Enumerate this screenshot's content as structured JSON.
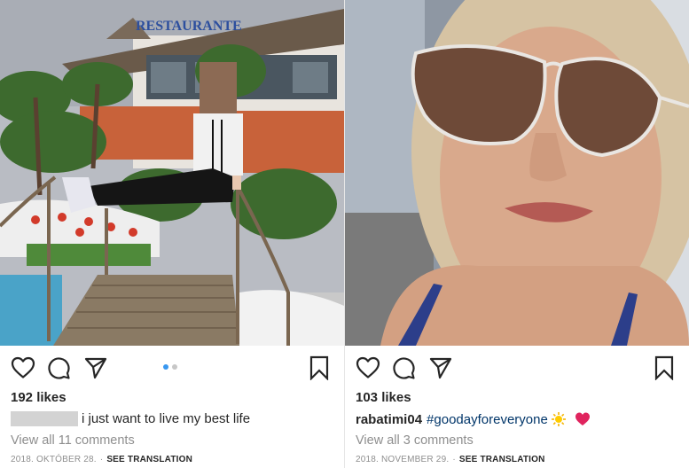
{
  "post_left": {
    "photo_description": "",
    "likes": "192 likes",
    "caption_text": "i just want to live my best life",
    "comments_link": "View all 11 comments",
    "date": "2018. OKTÓBER 28.",
    "separator": "·",
    "translation_link": "SEE TRANSLATION",
    "sign_text": "RESTAURANTE",
    "carousel": {
      "count": 2,
      "active_index": 0,
      "active_color": "#3897f0",
      "inactive_color": "#c7c7c7"
    },
    "icons": [
      "heart-icon",
      "comment-icon",
      "share-icon",
      "bookmark-icon"
    ]
  },
  "post_right": {
    "likes": "103 likes",
    "username": "rabatimi04",
    "hashtag": "#goodayforeveryone",
    "comments_link": "View all 3 comments",
    "date": "2018. NOVEMBER 29.",
    "separator": "·",
    "translation_link": "SEE TRANSLATION",
    "icons": [
      "heart-icon",
      "comment-icon",
      "share-icon",
      "bookmark-icon"
    ]
  },
  "colors": {
    "text": "#262626",
    "muted": "#8e8e8e",
    "hashtag": "#003569",
    "heart_emoji": "#e0245e"
  }
}
